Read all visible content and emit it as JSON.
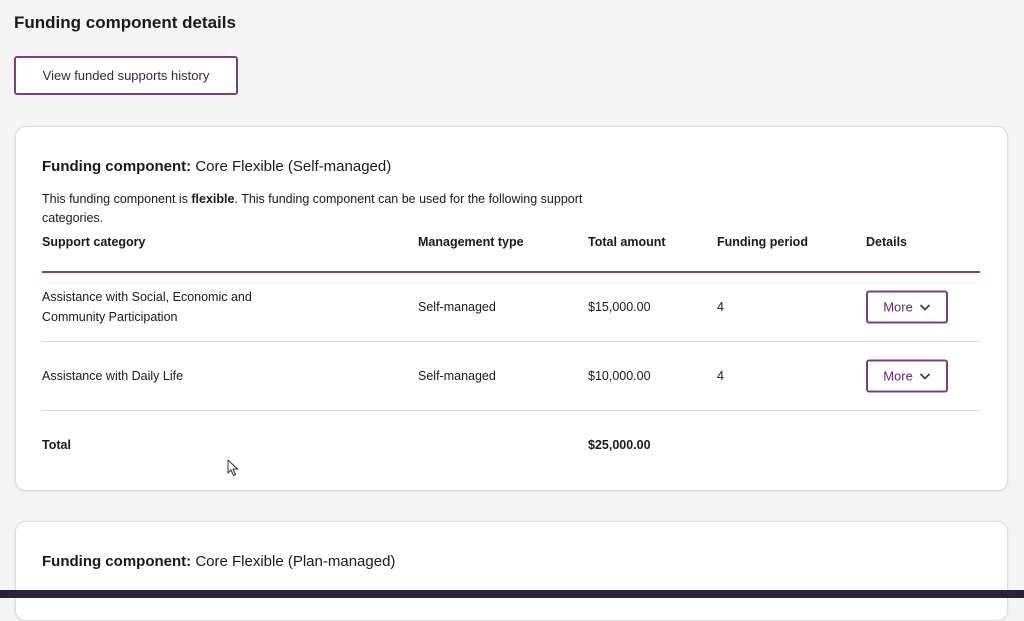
{
  "page": {
    "title": "Funding component details",
    "history_button_label": "View funded supports history"
  },
  "components": [
    {
      "title_label": "Funding component:",
      "title_value": "Core Flexible (Self-managed)",
      "description_pre": "This funding component is ",
      "description_bold": "flexible",
      "description_post": ". This funding component can be used for the following support categories.",
      "columns": {
        "category": "Support category",
        "management": "Management type",
        "amount": "Total amount",
        "period": "Funding period",
        "details": "Details"
      },
      "rows": [
        {
          "category": "Assistance with Social, Economic and Community Participation",
          "management": "Self-managed",
          "amount": "$15,000.00",
          "period": "4",
          "more_label": "More"
        },
        {
          "category": "Assistance with Daily Life",
          "management": "Self-managed",
          "amount": "$10,000.00",
          "period": "4",
          "more_label": "More"
        }
      ],
      "total": {
        "label": "Total",
        "amount": "$25,000.00"
      }
    },
    {
      "title_label": "Funding component:",
      "title_value": "Core Flexible (Plan-managed)"
    }
  ],
  "icons": {
    "chevron": "chevron-down-icon",
    "cursor": "mouse-cursor-icon"
  },
  "colors": {
    "accent": "#7b3f7f",
    "background": "#f4f4f4",
    "bottom_bar": "#2d2038"
  }
}
